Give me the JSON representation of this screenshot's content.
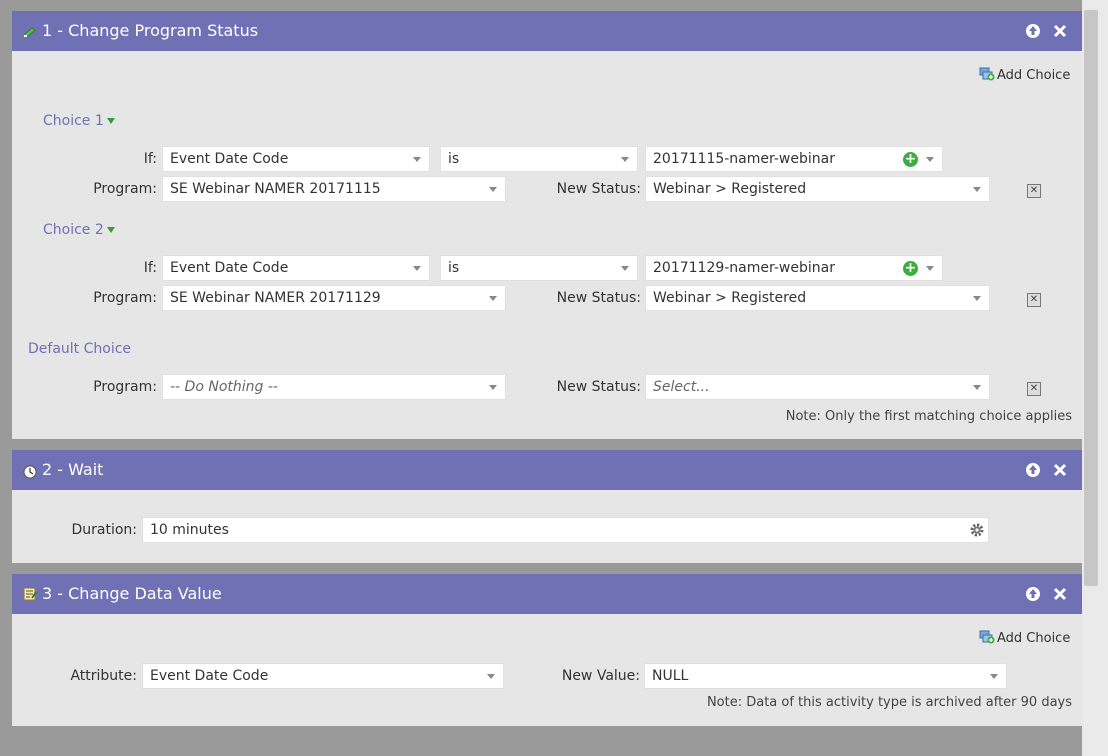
{
  "flows": [
    {
      "title": "1 - Change Program Status",
      "add_choice_label": "Add Choice",
      "choices": [
        {
          "label": "Choice 1",
          "if_label": "If:",
          "field": "Event Date Code",
          "operator": "is",
          "value": "20171115-namer-webinar",
          "program_label": "Program:",
          "program": "SE Webinar NAMER 20171115",
          "status_label": "New Status:",
          "status": "Webinar > Registered"
        },
        {
          "label": "Choice 2",
          "if_label": "If:",
          "field": "Event Date Code",
          "operator": "is",
          "value": "20171129-namer-webinar",
          "program_label": "Program:",
          "program": "SE Webinar NAMER 20171129",
          "status_label": "New Status:",
          "status": "Webinar > Registered"
        }
      ],
      "default_choice": {
        "label": "Default Choice",
        "program_label": "Program:",
        "program": "-- Do Nothing --",
        "status_label": "New Status:",
        "status": "Select..."
      },
      "note": "Note: Only the first matching choice applies"
    },
    {
      "title": "2 - Wait",
      "duration_label": "Duration:",
      "duration": "10 minutes"
    },
    {
      "title": "3 - Change Data Value",
      "add_choice_label": "Add Choice",
      "attribute_label": "Attribute:",
      "attribute": "Event Date Code",
      "new_value_label": "New Value:",
      "new_value": "NULL",
      "note": "Note: Data of this activity type is archived after 90 days"
    }
  ],
  "colors": {
    "header": "#7070b4",
    "panel": "#e6e6e6",
    "link": "#7070b4",
    "plus": "#3cae3c"
  },
  "icons": {
    "header_up": "arrow-up-icon",
    "header_close": "close-icon",
    "add": "plus-circle-icon",
    "delete": "delete-icon",
    "settings": "gear-icon"
  }
}
